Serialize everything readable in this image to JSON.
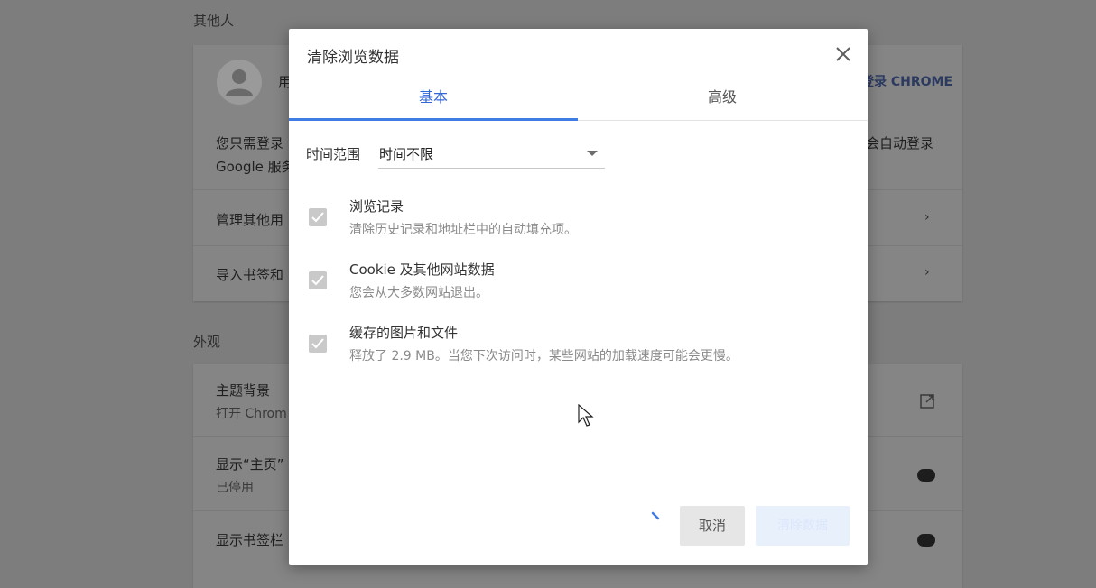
{
  "background": {
    "section_others": "其他人",
    "profile_name_fragment": "用",
    "signin_link": "登录 CHROME",
    "signin_text_line1": "您只需登录",
    "signin_text_line1_right": "会自动登录",
    "signin_text_line2": "Google 服务",
    "manage_others": "管理其他用",
    "import_bookmarks": "导入书签和",
    "section_appearance": "外观",
    "theme_title": "主题背景",
    "theme_sub": "打开 Chrom",
    "show_home_title": "显示“主页”",
    "show_home_sub": "已停用",
    "show_bookmarks": "显示书签栏"
  },
  "dialog": {
    "title": "清除浏览数据",
    "tabs": [
      {
        "label": "基本",
        "active": true
      },
      {
        "label": "高级",
        "active": false
      }
    ],
    "time_range_label": "时间范围",
    "time_range_value": "时间不限",
    "items": [
      {
        "title": "浏览记录",
        "desc": "清除历史记录和地址栏中的自动填充项。",
        "checked": true
      },
      {
        "title": "Cookie 及其他网站数据",
        "desc": "您会从大多数网站退出。",
        "checked": true
      },
      {
        "title": "缓存的图片和文件",
        "desc": "释放了 2.9 MB。当您下次访问时，某些网站的加载速度可能会更慢。",
        "checked": true
      }
    ],
    "cancel_label": "取消",
    "clear_label": "清除数据"
  },
  "colors": {
    "accent": "#3f7ce3",
    "overlay": "#7d7d7d",
    "checkbox_disabled": "#c9c9c9"
  },
  "icons": [
    "close-icon",
    "dropdown-arrow-icon",
    "checkmark-icon",
    "spinner-icon",
    "mouse-cursor-icon",
    "chevron-right-icon",
    "external-link-icon",
    "avatar-icon"
  ]
}
